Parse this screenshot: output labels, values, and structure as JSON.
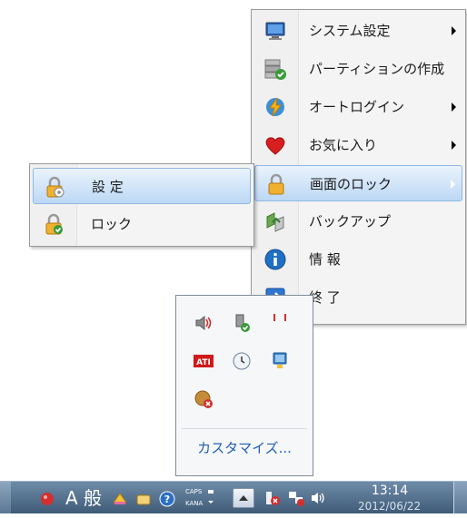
{
  "menu": {
    "items": [
      {
        "label": "システム設定",
        "icon": "monitor-icon",
        "has_submenu": true
      },
      {
        "label": "パーティションの作成",
        "icon": "disk-check-icon",
        "has_submenu": false
      },
      {
        "label": "オートログイン",
        "icon": "lightning-icon",
        "has_submenu": true
      },
      {
        "label": "お気に入り",
        "icon": "heart-icon",
        "has_submenu": true
      },
      {
        "label": "画面のロック",
        "icon": "lock-icon",
        "has_submenu": true,
        "highlighted": true
      },
      {
        "label": "バックアップ",
        "icon": "backup-icon",
        "has_submenu": false
      },
      {
        "label": "情 報",
        "icon": "info-icon",
        "has_submenu": false
      },
      {
        "label": "終 了",
        "icon": "exit-arrow-icon",
        "has_submenu": false
      }
    ]
  },
  "submenu": {
    "items": [
      {
        "label": "設 定",
        "icon": "lock-settings-icon",
        "highlighted": true
      },
      {
        "label": "ロック",
        "icon": "lock-check-icon",
        "highlighted": false
      }
    ]
  },
  "tray_overflow": {
    "icons": [
      "speaker-icon",
      "usb-safe-remove-icon",
      "flag-icon",
      "ati-icon",
      "clock-icon",
      "network-icon",
      "security-alert-icon"
    ],
    "customize_label": "カスタマイズ..."
  },
  "taskbar": {
    "ime_text": "A 般",
    "caps_label": "CAPS",
    "kana_label": "KANA",
    "time": "13:14",
    "date": "2012/06/22"
  },
  "colors": {
    "highlight_top": "#eaf3fc",
    "highlight_bottom": "#bcd8f5",
    "taskbar": "#4f6b88",
    "link": "#1f5fb3"
  }
}
